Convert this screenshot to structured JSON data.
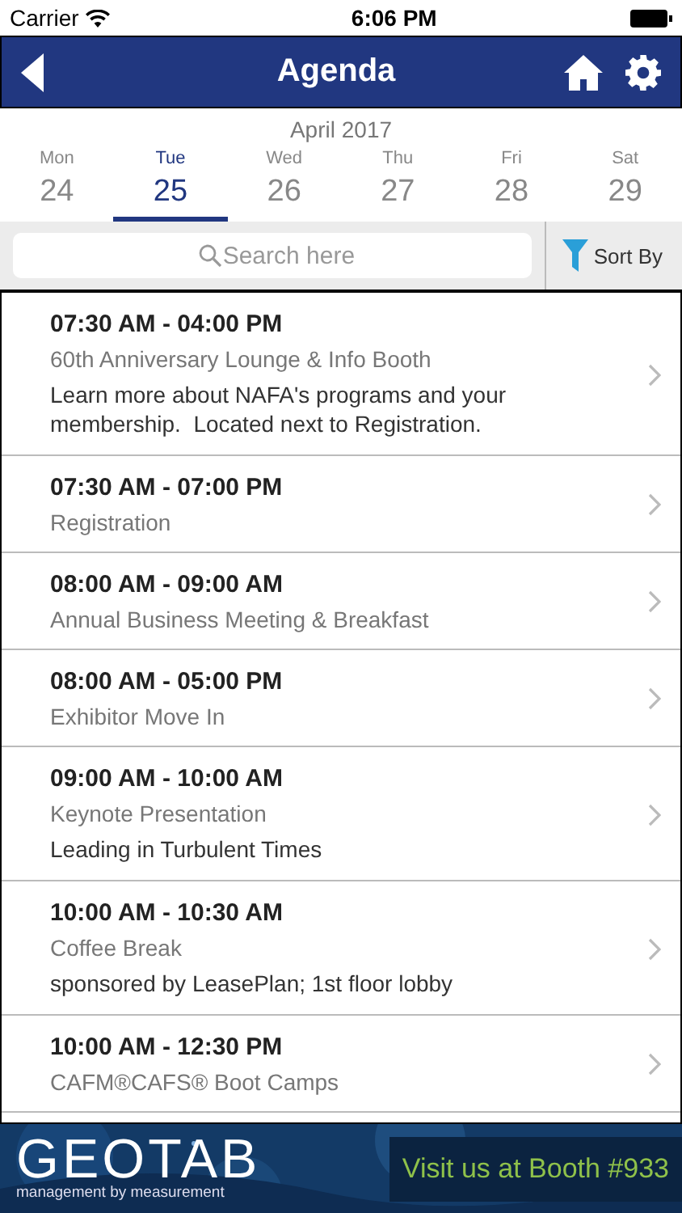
{
  "status_bar": {
    "carrier": "Carrier",
    "time": "6:06 PM"
  },
  "nav": {
    "title": "Agenda"
  },
  "month": "April 2017",
  "days": [
    {
      "weekday": "Mon",
      "date": "24",
      "selected": false
    },
    {
      "weekday": "Tue",
      "date": "25",
      "selected": true
    },
    {
      "weekday": "Wed",
      "date": "26",
      "selected": false
    },
    {
      "weekday": "Thu",
      "date": "27",
      "selected": false
    },
    {
      "weekday": "Fri",
      "date": "28",
      "selected": false
    },
    {
      "weekday": "Sat",
      "date": "29",
      "selected": false
    }
  ],
  "search": {
    "placeholder": "Search here"
  },
  "sort_button": "Sort By",
  "sessions": [
    {
      "time": "07:30 AM - 04:00 PM",
      "title": "60th Anniversary Lounge & Info Booth",
      "note": "Learn more about NAFA's programs and your membership.  Located next to Registration."
    },
    {
      "time": "07:30 AM - 07:00 PM",
      "title": "Registration"
    },
    {
      "time": "08:00 AM - 09:00 AM",
      "title": "Annual Business Meeting & Breakfast"
    },
    {
      "time": "08:00 AM - 05:00 PM",
      "title": "Exhibitor Move In"
    },
    {
      "time": "09:00 AM - 10:00 AM",
      "title": "Keynote Presentation",
      "note": "Leading in Turbulent Times"
    },
    {
      "time": "10:00 AM - 10:30 AM",
      "title": "Coffee Break",
      "note": "sponsored by LeasePlan; 1st floor lobby"
    },
    {
      "time": "10:00 AM - 12:30 PM",
      "title": "CAFM®CAFS® Boot Camps"
    }
  ],
  "banner": {
    "brand": "GEOTAB",
    "tagline": "management by measurement",
    "cta": "Visit us at Booth #933"
  }
}
